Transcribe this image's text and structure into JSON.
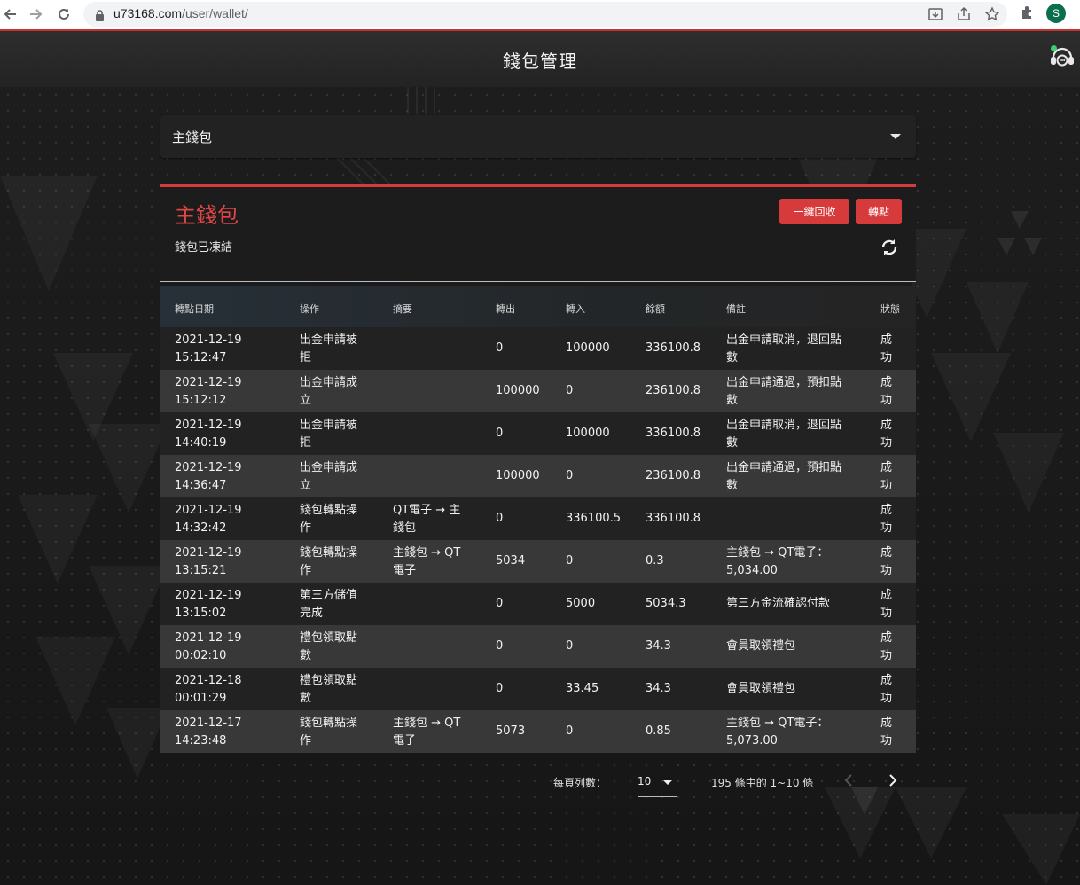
{
  "browser": {
    "url_host": "u73168.com",
    "url_path": "/user/wallet/",
    "profile_initial": "S"
  },
  "header": {
    "title": "錢包管理",
    "support_icon": "headset-icon"
  },
  "wallet_select": {
    "selected": "主錢包"
  },
  "wallet_card": {
    "name": "主錢包",
    "status": "錢包已凍結",
    "recycle_label": "一鍵回收",
    "transfer_label": "轉點",
    "accent_color": "#d73a3a"
  },
  "table": {
    "headers": [
      "轉點日期",
      "操作",
      "摘要",
      "轉出",
      "轉入",
      "餘額",
      "備註",
      "狀態"
    ],
    "rows": [
      {
        "date": "2021-12-19",
        "time": "15:12:47",
        "op1": "出金申請被",
        "op2": "拒",
        "sum1": "",
        "sum2": "",
        "out": "0",
        "in": "100000",
        "bal": "336100.8",
        "note1": "出金申請取消，退回點",
        "note2": "數",
        "st1": "成",
        "st2": "功"
      },
      {
        "date": "2021-12-19",
        "time": "15:12:12",
        "op1": "出金申請成",
        "op2": "立",
        "sum1": "",
        "sum2": "",
        "out": "100000",
        "in": "0",
        "bal": "236100.8",
        "note1": "出金申請通過，預扣點",
        "note2": "數",
        "st1": "成",
        "st2": "功"
      },
      {
        "date": "2021-12-19",
        "time": "14:40:19",
        "op1": "出金申請被",
        "op2": "拒",
        "sum1": "",
        "sum2": "",
        "out": "0",
        "in": "100000",
        "bal": "336100.8",
        "note1": "出金申請取消，退回點",
        "note2": "數",
        "st1": "成",
        "st2": "功"
      },
      {
        "date": "2021-12-19",
        "time": "14:36:47",
        "op1": "出金申請成",
        "op2": "立",
        "sum1": "",
        "sum2": "",
        "out": "100000",
        "in": "0",
        "bal": "236100.8",
        "note1": "出金申請通過，預扣點",
        "note2": "數",
        "st1": "成",
        "st2": "功"
      },
      {
        "date": "2021-12-19",
        "time": "14:32:42",
        "op1": "錢包轉點操",
        "op2": "作",
        "sum1": "QT電子 → 主",
        "sum2": "錢包",
        "out": "0",
        "in": "336100.5",
        "bal": "336100.8",
        "note1": "",
        "note2": "",
        "st1": "成",
        "st2": "功"
      },
      {
        "date": "2021-12-19",
        "time": "13:15:21",
        "op1": "錢包轉點操",
        "op2": "作",
        "sum1": "主錢包 → QT",
        "sum2": "電子",
        "out": "5034",
        "in": "0",
        "bal": "0.3",
        "note1": "主錢包 → QT電子：",
        "note2": "5,034.00",
        "st1": "成",
        "st2": "功"
      },
      {
        "date": "2021-12-19",
        "time": "13:15:02",
        "op1": "第三方儲值",
        "op2": "完成",
        "sum1": "",
        "sum2": "",
        "out": "0",
        "in": "5000",
        "bal": "5034.3",
        "note1": "第三方金流確認付款",
        "note2": "",
        "st1": "成",
        "st2": "功"
      },
      {
        "date": "2021-12-19",
        "time": "00:02:10",
        "op1": "禮包領取點",
        "op2": "數",
        "sum1": "",
        "sum2": "",
        "out": "0",
        "in": "0",
        "bal": "34.3",
        "note1": "會員取領禮包",
        "note2": "",
        "st1": "成",
        "st2": "功"
      },
      {
        "date": "2021-12-18",
        "time": "00:01:29",
        "op1": "禮包領取點",
        "op2": "數",
        "sum1": "",
        "sum2": "",
        "out": "0",
        "in": "33.45",
        "bal": "34.3",
        "note1": "會員取領禮包",
        "note2": "",
        "st1": "成",
        "st2": "功"
      },
      {
        "date": "2021-12-17",
        "time": "14:23:48",
        "op1": "錢包轉點操",
        "op2": "作",
        "sum1": "主錢包 → QT",
        "sum2": "電子",
        "out": "5073",
        "in": "0",
        "bal": "0.85",
        "note1": "主錢包 → QT電子：",
        "note2": "5,073.00",
        "st1": "成",
        "st2": "功"
      }
    ]
  },
  "pagination": {
    "rows_per_page_label": "每頁列數：",
    "rows_per_page": "10",
    "range_text": "195 條中的 1~10 條"
  }
}
